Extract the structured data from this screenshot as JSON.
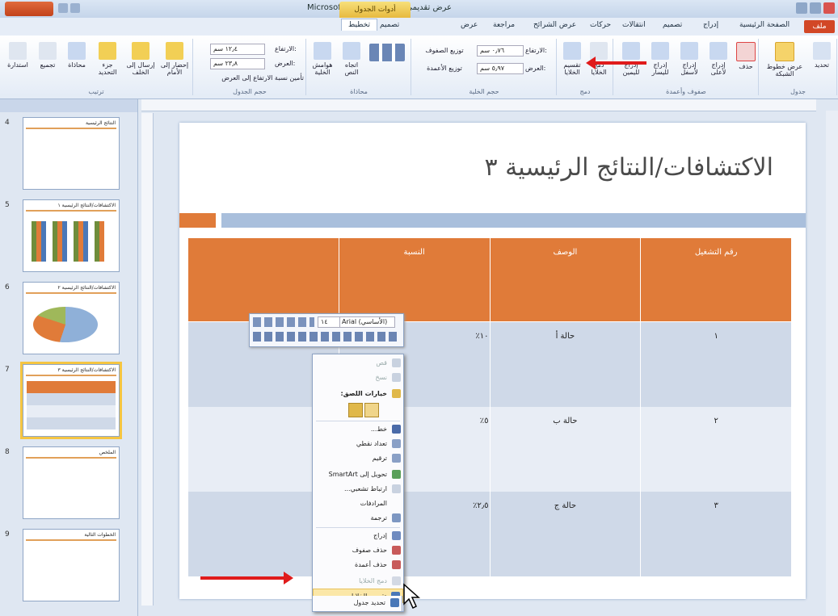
{
  "window": {
    "title": "Microsoft PowerPoint - عرض تقديمي ١",
    "context_tab_group": "أدوات الجدول"
  },
  "tabs": [
    {
      "label": "ملف"
    },
    {
      "label": "الصفحة الرئيسية"
    },
    {
      "label": "إدراج"
    },
    {
      "label": "تصميم"
    },
    {
      "label": "انتقالات"
    },
    {
      "label": "حركات"
    },
    {
      "label": "عرض الشرائح"
    },
    {
      "label": "مراجعة"
    },
    {
      "label": "عرض"
    },
    {
      "label": "تصميم"
    },
    {
      "label": "تخطيط"
    }
  ],
  "ribbon": {
    "groups": [
      {
        "label": "جدول"
      },
      {
        "label": "صفوف وأعمدة"
      },
      {
        "label": "دمج"
      },
      {
        "label": "حجم الخلية"
      },
      {
        "label": "محاذاة"
      },
      {
        "label": "حجم الجدول"
      },
      {
        "label": "ترتيب"
      }
    ],
    "buttons": {
      "select": "تحديد",
      "gridlines": "عرض خطوط الشبكة",
      "delete": "حذف",
      "insert_above": "إدراج لأعلى",
      "insert_below": "إدراج لأسفل",
      "insert_left": "إدراج لليسار",
      "insert_right": "إدراج لليمين",
      "merge_cells": "دمج الخلايا",
      "split_cells": "تقسيم الخلايا",
      "distribute_rows": "توزيع الصفوف",
      "distribute_columns": "توزيع الأعمدة",
      "text_direction": "اتجاه النص",
      "cell_margins": "هوامش الخلية",
      "lock_aspect": "تأمين نسبة الارتفاع إلى العرض",
      "bring_forward": "إحضار إلى الأمام",
      "send_backward": "إرسال إلى الخلف",
      "selection_pane": "جزء التحديد",
      "align": "محاذاة",
      "group": "تجميع",
      "rotate": "استدارة"
    },
    "inputs": {
      "row_height_label": "الارتفاع:",
      "row_height": "٠٫٧٦ سم",
      "col_width_label": "العرض:",
      "col_width": "٥٫٩٧ سم",
      "table_height_label": "الارتفاع:",
      "table_height": "١٢٫٤ سم",
      "table_width_label": "العرض:",
      "table_width": "٢٣٫٨ سم"
    }
  },
  "thumbnails": [
    {
      "num": "4",
      "title": "النتائج الرئيسية"
    },
    {
      "num": "5",
      "title": "الاكتشافات/النتائج الرئيسية ١"
    },
    {
      "num": "6",
      "title": "الاكتشافات/النتائج الرئيسية ٢"
    },
    {
      "num": "7",
      "title": "الاكتشافات/النتائج الرئيسية ٣"
    },
    {
      "num": "8",
      "title": "الملخص"
    },
    {
      "num": "9",
      "title": "الخطوات التالية"
    }
  ],
  "slide": {
    "title": "الاكتشافات/النتائج الرئيسية ٣",
    "table": {
      "headers": [
        "رقم التشغيل",
        "الوصف",
        "النسبة",
        ""
      ],
      "rows": [
        [
          "١",
          "حالة أ",
          "١٠٪",
          ""
        ],
        [
          "٢",
          "حالة ب",
          "٥٪",
          ""
        ],
        [
          "٣",
          "حالة ج",
          "٢٫٥٪",
          ""
        ]
      ]
    }
  },
  "mini_toolbar": {
    "font": "Arial (الأساسي)",
    "size": "١٤"
  },
  "context_menu": [
    {
      "label": "قص",
      "disabled": true
    },
    {
      "label": "نسخ",
      "disabled": true
    },
    {
      "label": "خيارات اللصق:",
      "disabled": false
    },
    {
      "label": "خط...",
      "disabled": false
    },
    {
      "label": "تعداد نقطي",
      "disabled": false
    },
    {
      "label": "ترقيم",
      "disabled": false
    },
    {
      "label": "تحويل إلى SmartArt",
      "disabled": false
    },
    {
      "label": "ارتباط تشعبي...",
      "disabled": false
    },
    {
      "label": "المرادفات",
      "disabled": false
    },
    {
      "label": "ترجمة",
      "disabled": false
    },
    {
      "label": "إدراج",
      "disabled": false
    },
    {
      "label": "حذف صفوف",
      "disabled": false
    },
    {
      "label": "حذف أعمدة",
      "disabled": false
    },
    {
      "label": "دمج الخلايا",
      "disabled": true
    },
    {
      "label": "تقسيم الخلايا...",
      "disabled": false
    },
    {
      "label": "تحديد جدول",
      "disabled": false
    }
  ]
}
